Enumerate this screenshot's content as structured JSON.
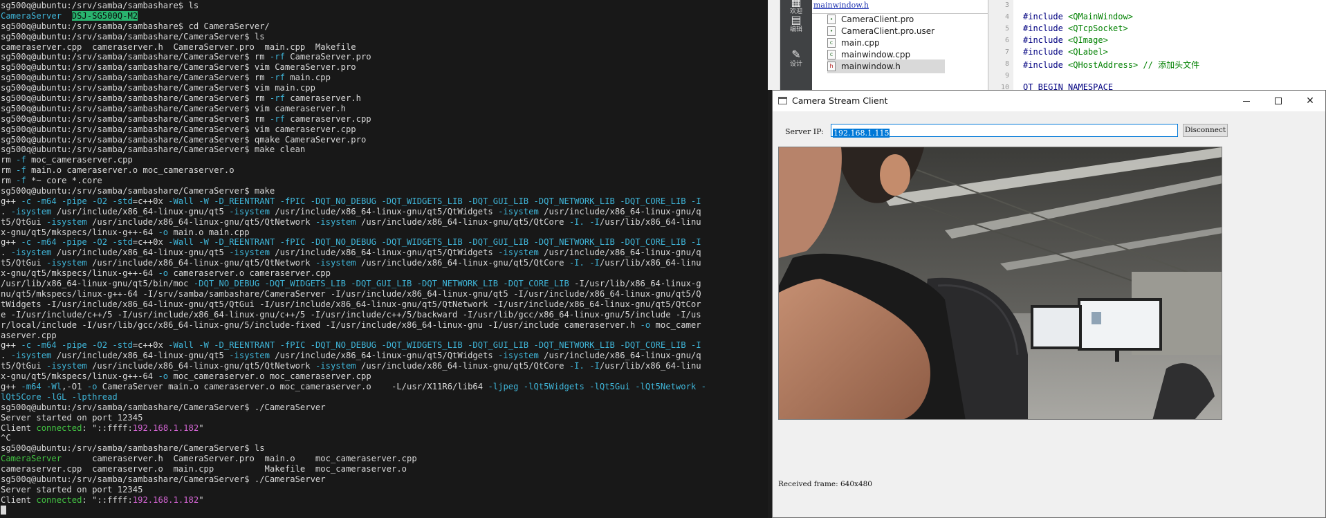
{
  "terminal": {
    "lines": [
      [
        [
          "t",
          "sg500q@ubuntu:/srv/samba/sambashare$ ls"
        ]
      ],
      [
        [
          "dir",
          "CameraServer"
        ],
        [
          "t",
          "  "
        ],
        [
          "hl",
          "DSJ-SG500Q-M2"
        ]
      ],
      [
        [
          "t",
          "sg500q@ubuntu:/srv/samba/sambashare$ cd CameraServer/"
        ]
      ],
      [
        [
          "t",
          "sg500q@ubuntu:/srv/samba/sambashare/CameraServer$ ls"
        ]
      ],
      [
        [
          "t",
          "cameraserver.cpp  cameraserver.h  CameraServer.pro  main.cpp  Makefile"
        ]
      ],
      [
        [
          "t",
          "sg500q@ubuntu:/srv/samba/sambashare/CameraServer$ rm "
        ],
        [
          "c",
          "-rf"
        ],
        [
          "t",
          " CameraServer.pro"
        ]
      ],
      [
        [
          "t",
          "sg500q@ubuntu:/srv/samba/sambashare/CameraServer$ vim CameraServer.pro"
        ]
      ],
      [
        [
          "t",
          "sg500q@ubuntu:/srv/samba/sambashare/CameraServer$ rm "
        ],
        [
          "c",
          "-rf"
        ],
        [
          "t",
          " main.cpp"
        ]
      ],
      [
        [
          "t",
          "sg500q@ubuntu:/srv/samba/sambashare/CameraServer$ vim main.cpp"
        ]
      ],
      [
        [
          "t",
          "sg500q@ubuntu:/srv/samba/sambashare/CameraServer$ rm "
        ],
        [
          "c",
          "-rf"
        ],
        [
          "t",
          " cameraserver.h"
        ]
      ],
      [
        [
          "t",
          "sg500q@ubuntu:/srv/samba/sambashare/CameraServer$ vim cameraserver.h"
        ]
      ],
      [
        [
          "t",
          "sg500q@ubuntu:/srv/samba/sambashare/CameraServer$ rm "
        ],
        [
          "c",
          "-rf"
        ],
        [
          "t",
          " cameraserver.cpp"
        ]
      ],
      [
        [
          "t",
          "sg500q@ubuntu:/srv/samba/sambashare/CameraServer$ vim cameraserver.cpp"
        ]
      ],
      [
        [
          "t",
          "sg500q@ubuntu:/srv/samba/sambashare/CameraServer$ qmake CameraServer.pro"
        ]
      ],
      [
        [
          "t",
          "sg500q@ubuntu:/srv/samba/sambashare/CameraServer$ make clean"
        ]
      ],
      [
        [
          "t",
          "rm "
        ],
        [
          "c",
          "-f"
        ],
        [
          "t",
          " moc_cameraserver.cpp"
        ]
      ],
      [
        [
          "t",
          "rm "
        ],
        [
          "c",
          "-f"
        ],
        [
          "t",
          " main.o cameraserver.o moc_cameraserver.o"
        ]
      ],
      [
        [
          "t",
          "rm "
        ],
        [
          "c",
          "-f"
        ],
        [
          "t",
          " *~ core *.core"
        ]
      ],
      [
        [
          "t",
          "sg500q@ubuntu:/srv/samba/sambashare/CameraServer$ make"
        ]
      ],
      [
        [
          "t",
          "g++ "
        ],
        [
          "c",
          "-c -m64 -pipe -O2 -std"
        ],
        [
          "t",
          "=c++0x "
        ],
        [
          "c",
          "-Wall -W -D_REENTRANT -fPIC -DQT_NO_DEBUG -DQT_WIDGETS_LIB -DQT_GUI_LIB -DQT_NETWORK_LIB -DQT_CORE_LIB -I"
        ]
      ],
      [
        [
          "t",
          ". "
        ],
        [
          "c",
          "-isystem"
        ],
        [
          "t",
          " /usr/include/x86_64-linux-gnu/qt5 "
        ],
        [
          "c",
          "-isystem"
        ],
        [
          "t",
          " /usr/include/x86_64-linux-gnu/qt5/QtWidgets "
        ],
        [
          "c",
          "-isystem"
        ],
        [
          "t",
          " /usr/include/x86_64-linux-gnu/q"
        ]
      ],
      [
        [
          "t",
          "t5/QtGui "
        ],
        [
          "c",
          "-isystem"
        ],
        [
          "t",
          " /usr/include/x86_64-linux-gnu/qt5/QtNetwork "
        ],
        [
          "c",
          "-isystem"
        ],
        [
          "t",
          " /usr/include/x86_64-linux-gnu/qt5/QtCore "
        ],
        [
          "c",
          "-I."
        ],
        [
          "t",
          " "
        ],
        [
          "c",
          "-I"
        ],
        [
          "t",
          "/usr/lib/x86_64-linu"
        ]
      ],
      [
        [
          "t",
          "x-gnu/qt5/mkspecs/linux-g++-64 "
        ],
        [
          "c",
          "-o"
        ],
        [
          "t",
          " main.o main.cpp"
        ]
      ],
      [
        [
          "t",
          "g++ "
        ],
        [
          "c",
          "-c -m64 -pipe -O2 -std"
        ],
        [
          "t",
          "=c++0x "
        ],
        [
          "c",
          "-Wall -W -D_REENTRANT -fPIC -DQT_NO_DEBUG -DQT_WIDGETS_LIB -DQT_GUI_LIB -DQT_NETWORK_LIB -DQT_CORE_LIB -I"
        ]
      ],
      [
        [
          "t",
          ". "
        ],
        [
          "c",
          "-isystem"
        ],
        [
          "t",
          " /usr/include/x86_64-linux-gnu/qt5 "
        ],
        [
          "c",
          "-isystem"
        ],
        [
          "t",
          " /usr/include/x86_64-linux-gnu/qt5/QtWidgets "
        ],
        [
          "c",
          "-isystem"
        ],
        [
          "t",
          " /usr/include/x86_64-linux-gnu/q"
        ]
      ],
      [
        [
          "t",
          "t5/QtGui "
        ],
        [
          "c",
          "-isystem"
        ],
        [
          "t",
          " /usr/include/x86_64-linux-gnu/qt5/QtNetwork "
        ],
        [
          "c",
          "-isystem"
        ],
        [
          "t",
          " /usr/include/x86_64-linux-gnu/qt5/QtCore "
        ],
        [
          "c",
          "-I."
        ],
        [
          "t",
          " "
        ],
        [
          "c",
          "-I"
        ],
        [
          "t",
          "/usr/lib/x86_64-linu"
        ]
      ],
      [
        [
          "t",
          "x-gnu/qt5/mkspecs/linux-g++-64 "
        ],
        [
          "c",
          "-o"
        ],
        [
          "t",
          " cameraserver.o cameraserver.cpp"
        ]
      ],
      [
        [
          "t",
          "/usr/lib/x86_64-linux-gnu/qt5/bin/moc "
        ],
        [
          "c",
          "-DQT_NO_DEBUG -DQT_WIDGETS_LIB -DQT_GUI_LIB -DQT_NETWORK_LIB -DQT_CORE_LIB"
        ],
        [
          "t",
          " -I/usr/lib/x86_64-linux-g"
        ]
      ],
      [
        [
          "t",
          "nu/qt5/mkspecs/linux-g++-64 -I/srv/samba/sambashare/CameraServer -I/usr/include/x86_64-linux-gnu/qt5 -I/usr/include/x86_64-linux-gnu/qt5/Q"
        ]
      ],
      [
        [
          "t",
          "tWidgets -I/usr/include/x86_64-linux-gnu/qt5/QtGui -I/usr/include/x86_64-linux-gnu/qt5/QtNetwork -I/usr/include/x86_64-linux-gnu/qt5/QtCor"
        ]
      ],
      [
        [
          "t",
          "e -I/usr/include/c++/5 -I/usr/include/x86_64-linux-gnu/c++/5 -I/usr/include/c++/5/backward -I/usr/lib/gcc/x86_64-linux-gnu/5/include -I/us"
        ]
      ],
      [
        [
          "t",
          "r/local/include -I/usr/lib/gcc/x86_64-linux-gnu/5/include-fixed -I/usr/include/x86_64-linux-gnu -I/usr/include cameraserver.h "
        ],
        [
          "c",
          "-o"
        ],
        [
          "t",
          " moc_camer"
        ]
      ],
      [
        [
          "t",
          "aserver.cpp"
        ]
      ],
      [
        [
          "t",
          "g++ "
        ],
        [
          "c",
          "-c -m64 -pipe -O2 -std"
        ],
        [
          "t",
          "=c++0x "
        ],
        [
          "c",
          "-Wall -W -D_REENTRANT -fPIC -DQT_NO_DEBUG -DQT_WIDGETS_LIB -DQT_GUI_LIB -DQT_NETWORK_LIB -DQT_CORE_LIB -I"
        ]
      ],
      [
        [
          "t",
          ". "
        ],
        [
          "c",
          "-isystem"
        ],
        [
          "t",
          " /usr/include/x86_64-linux-gnu/qt5 "
        ],
        [
          "c",
          "-isystem"
        ],
        [
          "t",
          " /usr/include/x86_64-linux-gnu/qt5/QtWidgets "
        ],
        [
          "c",
          "-isystem"
        ],
        [
          "t",
          " /usr/include/x86_64-linux-gnu/q"
        ]
      ],
      [
        [
          "t",
          "t5/QtGui "
        ],
        [
          "c",
          "-isystem"
        ],
        [
          "t",
          " /usr/include/x86_64-linux-gnu/qt5/QtNetwork "
        ],
        [
          "c",
          "-isystem"
        ],
        [
          "t",
          " /usr/include/x86_64-linux-gnu/qt5/QtCore "
        ],
        [
          "c",
          "-I."
        ],
        [
          "t",
          " "
        ],
        [
          "c",
          "-I"
        ],
        [
          "t",
          "/usr/lib/x86_64-linu"
        ]
      ],
      [
        [
          "t",
          "x-gnu/qt5/mkspecs/linux-g++-64 "
        ],
        [
          "c",
          "-o"
        ],
        [
          "t",
          " moc_cameraserver.o moc_cameraserver.cpp"
        ]
      ],
      [
        [
          "t",
          "g++ "
        ],
        [
          "c",
          "-m64 -Wl"
        ],
        [
          "t",
          ",-O1 "
        ],
        [
          "c",
          "-o"
        ],
        [
          "t",
          " CameraServer main.o cameraserver.o moc_cameraserver.o    -L/usr/X11R6/lib64 "
        ],
        [
          "c",
          "-ljpeg -lQt5Widgets -lQt5Gui -lQt5Network -"
        ]
      ],
      [
        [
          "c",
          "lQt5Core -lGL -lpthread"
        ]
      ],
      [
        [
          "t",
          "sg500q@ubuntu:/srv/samba/sambashare/CameraServer$ ./CameraServer"
        ]
      ],
      [
        [
          "t",
          "Server started on port 12345"
        ]
      ],
      [
        [
          "t",
          "Client "
        ],
        [
          "g",
          "connected"
        ],
        [
          "t",
          ": \"::ffff:"
        ],
        [
          "m",
          "192.168.1.182"
        ],
        [
          "t",
          "\""
        ]
      ],
      [
        [
          "t",
          "^C"
        ]
      ],
      [
        [
          "t",
          "sg500q@ubuntu:/srv/samba/sambashare/CameraServer$ ls"
        ]
      ],
      [
        [
          "g",
          "CameraServer"
        ],
        [
          "t",
          "      cameraserver.h  CameraServer.pro  main.o    moc_cameraserver.cpp"
        ]
      ],
      [
        [
          "t",
          "cameraserver.cpp  cameraserver.o  main.cpp          Makefile  moc_cameraserver.o"
        ]
      ],
      [
        [
          "t",
          "sg500q@ubuntu:/srv/samba/sambashare/CameraServer$ ./CameraServer"
        ]
      ],
      [
        [
          "t",
          "Server started on port 12345"
        ]
      ],
      [
        [
          "t",
          "Client "
        ],
        [
          "g",
          "connected"
        ],
        [
          "t",
          ": \"::ffff:"
        ],
        [
          "m",
          "192.168.1.182"
        ],
        [
          "t",
          "\""
        ]
      ],
      [
        [
          "cursor",
          ""
        ]
      ]
    ]
  },
  "ide": {
    "modes": [
      {
        "label": "欢迎",
        "icon": "welcome-icon",
        "glyph": "▦"
      },
      {
        "label": "编辑",
        "icon": "edit-icon",
        "glyph": "▤"
      },
      {
        "label": "设计",
        "icon": "design-icon",
        "glyph": "✎"
      }
    ],
    "project_header": "mainwindow.h",
    "files": [
      {
        "name": "CameraClient.pro",
        "type": "pro"
      },
      {
        "name": "CameraClient.pro.user",
        "type": "user"
      },
      {
        "name": "main.cpp",
        "type": "cpp"
      },
      {
        "name": "mainwindow.cpp",
        "type": "cpp"
      },
      {
        "name": "mainwindow.h",
        "type": "h",
        "selected": true
      }
    ],
    "line_numbers": [
      "3",
      "4",
      "5",
      "6",
      "7",
      "8",
      "9",
      "10"
    ],
    "code_lines": [
      {
        "kw": "#include",
        "hdr": "<QMainWindow>",
        "cmt": ""
      },
      {
        "kw": "#include",
        "hdr": "<QTcpSocket>",
        "cmt": ""
      },
      {
        "kw": "#include",
        "hdr": "<QImage>",
        "cmt": ""
      },
      {
        "kw": "#include",
        "hdr": "<QLabel>",
        "cmt": ""
      },
      {
        "kw": "#include",
        "hdr": "<QHostAddress>",
        "cmt": " // 添加头文件"
      },
      {
        "kw": "",
        "hdr": "",
        "cmt": ""
      },
      {
        "kw": "QT_BEGIN_NAMESPACE",
        "hdr": "",
        "cmt": ""
      }
    ]
  },
  "client": {
    "title": "Camera Stream Client",
    "server_label": "Server IP:",
    "server_ip": "192.168.1.115",
    "disconnect_label": "Disconnect",
    "frame_status": "Received frame: 640x480",
    "colors": {
      "accent": "#0078d7"
    }
  }
}
